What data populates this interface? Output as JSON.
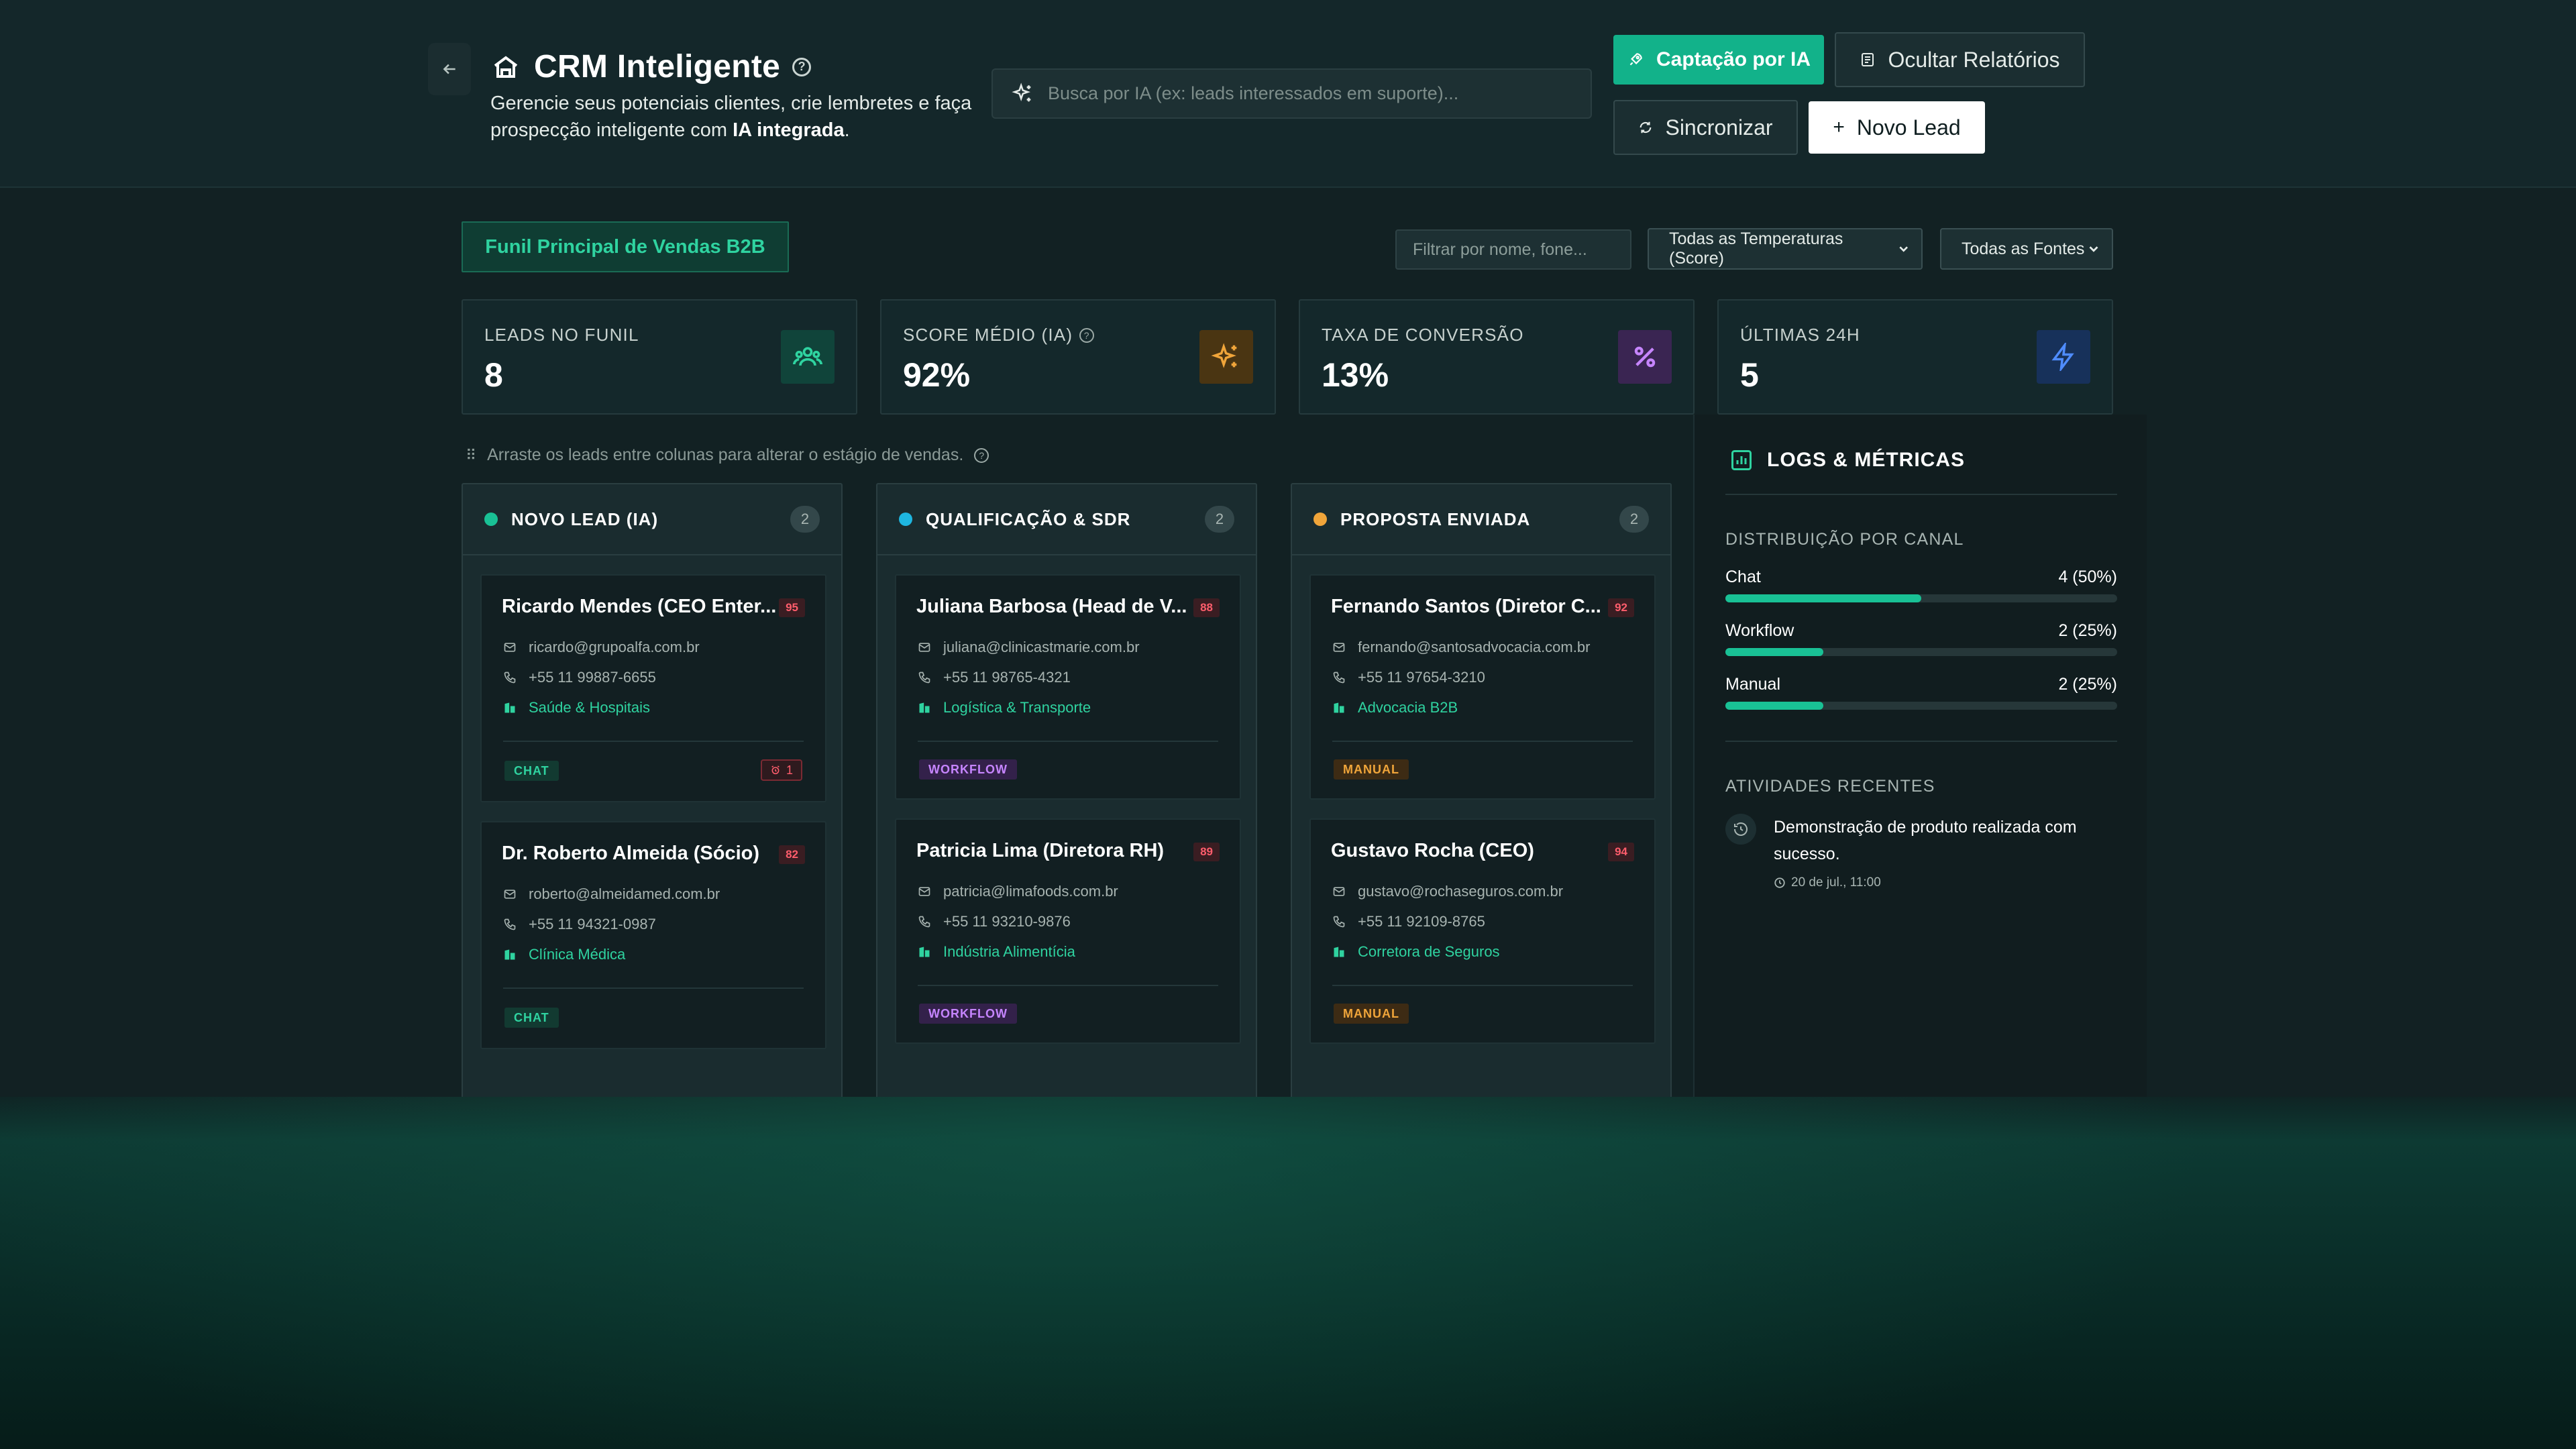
{
  "header": {
    "back_icon": "arrow-left-icon",
    "title": "CRM Inteligente",
    "title_icon": "hand-house-icon",
    "subtitle_pre": "Gerencie seus potenciais clientes, crie lembretes e faça prospecção inteligente com",
    "subtitle_bold": "IA integrada",
    "subtitle_post": ".",
    "search_placeholder": "Busca por IA (ex: leads interessados em suporte)...",
    "buttons": {
      "captacao": "Captação por IA",
      "ocultar": "Ocultar Relatórios",
      "sincronizar": "Sincronizar",
      "novo_lead": "Novo Lead"
    }
  },
  "toolbar": {
    "funnel": "Funil Principal de Vendas B2B",
    "filter_placeholder": "Filtrar por nome, fone...",
    "temperature_select": "Todas as Temperaturas (Score)",
    "source_select": "Todas as Fontes"
  },
  "stats": [
    {
      "label": "LEADS NO FUNIL",
      "value": "8",
      "icon": "users-icon",
      "color": "#2fd3a0"
    },
    {
      "label": "SCORE MÉDIO (IA)",
      "value": "92%",
      "icon": "sparkles-icon",
      "color": "#f0a53a"
    },
    {
      "label": "TAXA DE CONVERSÃO",
      "value": "13%",
      "icon": "percent-icon",
      "color": "#c685ff"
    },
    {
      "label": "ÚLTIMAS 24H",
      "value": "5",
      "icon": "lightning-icon",
      "color": "#4f8cff"
    }
  ],
  "hint": "Arraste os leads entre colunas para alterar o estágio de vendas.",
  "columns": [
    {
      "name": "NOVO LEAD (IA)",
      "count": "2",
      "color": "#19c195",
      "cards": [
        {
          "name": "Ricardo Mendes (CEO Enter...",
          "score": "95",
          "email": "ricardo@grupoalfa.com.br",
          "phone": "+55 11 99887-6655",
          "industry": "Saúde & Hospitais",
          "tag": "CHAT",
          "alarm": "1"
        },
        {
          "name": "Dr. Roberto Almeida (Sócio)",
          "score": "82",
          "email": "roberto@almeidamed.com.br",
          "phone": "+55 11 94321-0987",
          "industry": "Clínica Médica",
          "tag": "CHAT"
        }
      ]
    },
    {
      "name": "QUALIFICAÇÃO & SDR",
      "count": "2",
      "color": "#1eb6e0",
      "cards": [
        {
          "name": "Juliana Barbosa (Head de V...",
          "score": "88",
          "email": "juliana@clinicastmarie.com.br",
          "phone": "+55 11 98765-4321",
          "industry": "Logística & Transporte",
          "tag": "WORKFLOW"
        },
        {
          "name": "Patricia Lima (Diretora RH)",
          "score": "89",
          "email": "patricia@limafoods.com.br",
          "phone": "+55 11 93210-9876",
          "industry": "Indústria Alimentícia",
          "tag": "WORKFLOW"
        }
      ]
    },
    {
      "name": "PROPOSTA ENVIADA",
      "count": "2",
      "color": "#f0a53a",
      "cards": [
        {
          "name": "Fernando Santos (Diretor C...",
          "score": "92",
          "email": "fernando@santosadvocacia.com.br",
          "phone": "+55 11 97654-3210",
          "industry": "Advocacia B2B",
          "tag": "MANUAL"
        },
        {
          "name": "Gustavo Rocha (CEO)",
          "score": "94",
          "email": "gustavo@rochaseguros.com.br",
          "phone": "+55 11 92109-8765",
          "industry": "Corretora de Seguros",
          "tag": "MANUAL"
        }
      ]
    }
  ],
  "panel": {
    "title": "LOGS & MÉTRICAS",
    "channel_title": "DISTRIBUIÇÃO POR CANAL",
    "channels": [
      {
        "label": "Chat",
        "value": "4 (50%)",
        "fraction": 0.5
      },
      {
        "label": "Workflow",
        "value": "2 (25%)",
        "fraction": 0.25
      },
      {
        "label": "Manual",
        "value": "2 (25%)",
        "fraction": 0.25
      }
    ],
    "activity_title": "ATIVIDADES RECENTES",
    "activity": {
      "text": "Demonstração de produto realizada com sucesso.",
      "time": "20 de jul., 11:00"
    }
  }
}
